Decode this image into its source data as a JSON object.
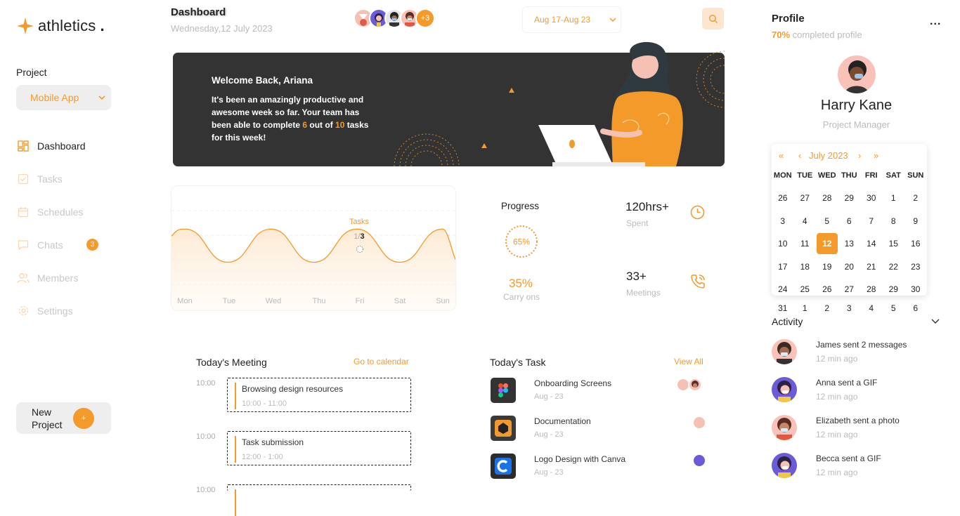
{
  "brand": {
    "name": "athletics",
    "dot": "."
  },
  "sidebar": {
    "project_label": "Project",
    "project_value": "Mobile App",
    "items": [
      {
        "label": "Dashboard",
        "icon": "grid-icon"
      },
      {
        "label": "Tasks",
        "icon": "checkbox-icon"
      },
      {
        "label": "Schedules",
        "icon": "calendar-icon"
      },
      {
        "label": "Chats",
        "icon": "chat-icon",
        "badge": "3"
      },
      {
        "label": "Members",
        "icon": "users-icon"
      },
      {
        "label": "Settings",
        "icon": "gear-icon"
      }
    ],
    "new_project_line1": "New",
    "new_project_line2": "Project",
    "new_project_plus": "+"
  },
  "header": {
    "title": "Dashboard",
    "date": "Wednesday,12 July 2023",
    "avatars_more": "+3",
    "date_range": "Aug 17-Aug 23"
  },
  "banner": {
    "greeting": "Welcome Back, Ariana",
    "body_before": "It's been an amazingly productive and awesome week so far. Your team has been able to complete ",
    "done": "6",
    "body_mid": " out of ",
    "total": "10",
    "body_after": " tasks for this week!"
  },
  "chart": {
    "tooltip_label": "Tasks",
    "tooltip_value_a": "1/",
    "tooltip_value_b": "3"
  },
  "chart_data": {
    "type": "area",
    "categories": [
      "Mon",
      "Tue",
      "Wed",
      "Thu",
      "Fri",
      "Sat",
      "Sun"
    ],
    "values": [
      3,
      1.2,
      3,
      1.2,
      3,
      1.2,
      3
    ],
    "accent": "#f39a2b"
  },
  "stats": {
    "progress_title": "Progress",
    "progress_value": "65%",
    "progress_fraction": 0.65,
    "carry_value": "35%",
    "carry_label": "Carry ons",
    "hours_value": "120hrs+",
    "hours_label": "Spent",
    "meetings_value": "33+",
    "meetings_label": "Meetings"
  },
  "meetings": {
    "title": "Today's Meeting",
    "link": "Go to calendar",
    "items": [
      {
        "time": "10:00",
        "title": "Browsing design resources",
        "range": "10:00 - 11:00"
      },
      {
        "time": "10:00",
        "title": "Task submission",
        "range": "12:00 - 1:00"
      },
      {
        "time": "10:00"
      }
    ]
  },
  "tasks": {
    "title": "Today's Task",
    "link": "View All",
    "items": [
      {
        "name": "Onboarding Screens",
        "date": "Aug - 23",
        "icon": "figma-icon"
      },
      {
        "name": "Documentation",
        "date": "Aug - 23",
        "icon": "doc-icon"
      },
      {
        "name": "Logo Design with Canva",
        "date": "Aug - 23",
        "icon": "canva-icon"
      }
    ]
  },
  "profile": {
    "title": "Profile",
    "completed_pct": "70%",
    "completed_text": " completed profile",
    "more": "...",
    "name": "Harry Kane",
    "role": "Project Manager"
  },
  "calendar": {
    "prev_year": "«",
    "prev_month": "‹",
    "month": "July 2023",
    "next_month": "›",
    "next_year": "»",
    "dow": [
      "MON",
      "TUE",
      "WED",
      "THU",
      "FRI",
      "SAT",
      "SUN"
    ],
    "days": [
      "26",
      "27",
      "28",
      "29",
      "30",
      "1",
      "2",
      "3",
      "4",
      "5",
      "6",
      "7",
      "8",
      "9",
      "10",
      "11",
      "12",
      "13",
      "14",
      "15",
      "16",
      "17",
      "18",
      "19",
      "20",
      "21",
      "22",
      "23",
      "24",
      "25",
      "26",
      "27",
      "28",
      "29",
      "30"
    ],
    "selected": "12",
    "overflow_row": [
      "31",
      "1",
      "2",
      "3",
      "4",
      "5",
      "6"
    ]
  },
  "activity": {
    "title": "Activity",
    "items": [
      {
        "text": "James sent 2 messages",
        "time": "12 min ago"
      },
      {
        "text": "Anna sent a GIF",
        "time": "12 min ago"
      },
      {
        "text": "Elizabeth sent a photo",
        "time": "12 min ago"
      },
      {
        "text": "Becca sent a GIF",
        "time": "12 min ago"
      }
    ]
  }
}
